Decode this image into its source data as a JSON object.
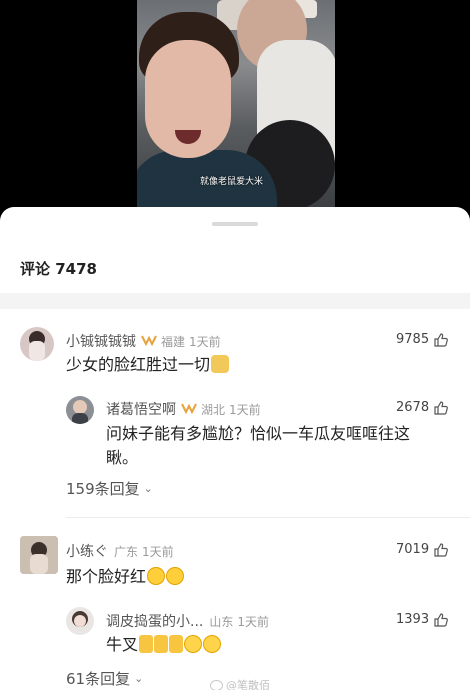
{
  "video": {
    "subtitle": "就像老鼠爱大米"
  },
  "sheet": {
    "title_label": "评论",
    "comment_count": "7478"
  },
  "comments": [
    {
      "name": "小铖铖铖铖",
      "location": "福建",
      "time": "1天前",
      "likes": "9785",
      "text": "少女的脸红胜过一切",
      "avatar_color": "#d7c7c5",
      "replies": [
        {
          "name": "诸葛悟空啊",
          "location": "湖北",
          "time": "1天前",
          "likes": "2678",
          "text_line1": "问妹子能有多尴尬？恰似一车瓜友哐哐往这",
          "text_line2": "瞅。",
          "avatar_color": "#8c8f93"
        }
      ],
      "replies_link": "159条回复"
    },
    {
      "name": "小练ぐ",
      "location": "广东",
      "time": "1天前",
      "likes": "7019",
      "text": "那个脸好红",
      "avatar_color": "#b8a896",
      "replies": [
        {
          "name": "调皮捣蛋的小...",
          "location": "山东",
          "time": "1天前",
          "likes": "1393",
          "text": "牛叉",
          "avatar_color": "#e9e6e4"
        }
      ],
      "replies_link": "61条回复"
    }
  ],
  "watermark": "@笔散佰",
  "icons": {
    "vip": "vip-badge-icon",
    "like": "thumb-up-icon",
    "chevron": "chevron-down-icon"
  },
  "colors": {
    "vip_gold": "#e6a23c",
    "muted_text": "#9a9a9a"
  }
}
